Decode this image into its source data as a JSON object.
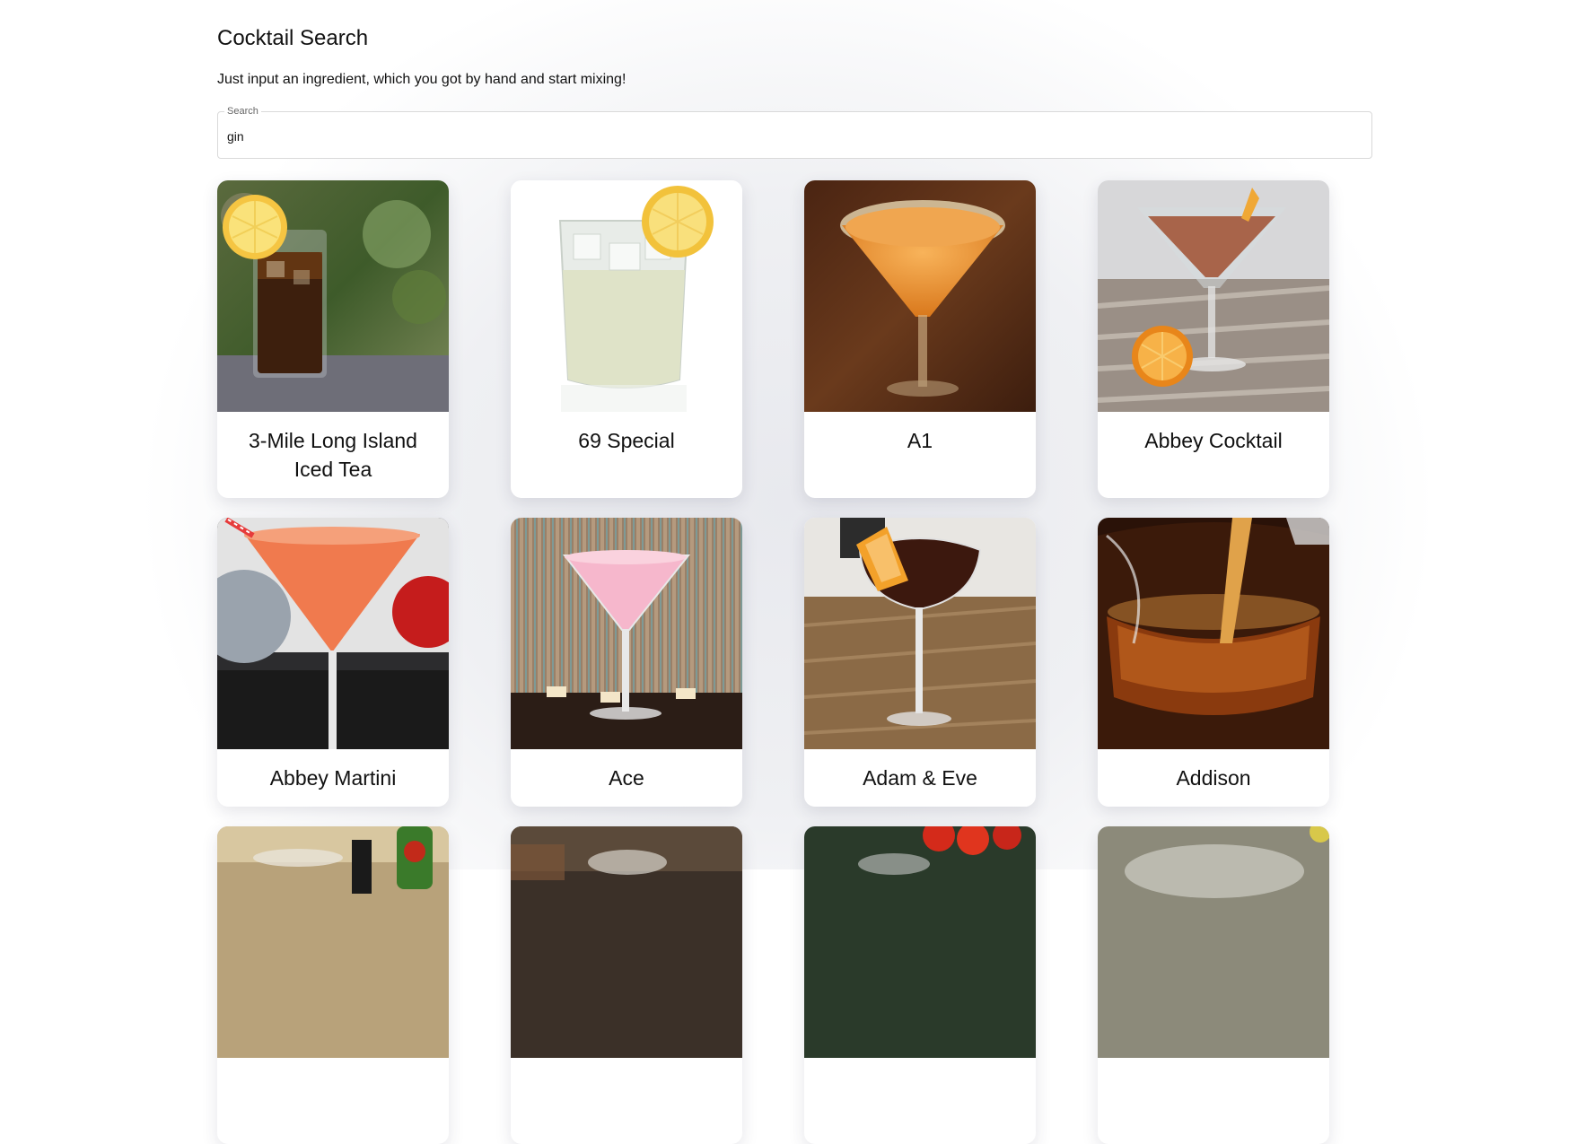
{
  "header": {
    "title": "Cocktail Search",
    "subtitle": "Just input an ingredient, which you got by hand and start mixing!"
  },
  "search": {
    "label": "Search",
    "value": "gin"
  },
  "cocktails": [
    {
      "name": "3-Mile Long Island Iced Tea",
      "image_icon": "iced-tea-highball-icon"
    },
    {
      "name": "69 Special",
      "image_icon": "lemon-rocks-glass-icon"
    },
    {
      "name": "A1",
      "image_icon": "orange-martini-icon"
    },
    {
      "name": "Abbey Cocktail",
      "image_icon": "martini-orange-slice-icon"
    },
    {
      "name": "Abbey Martini",
      "image_icon": "red-martini-icon"
    },
    {
      "name": "Ace",
      "image_icon": "pink-martini-icon"
    },
    {
      "name": "Adam & Eve",
      "image_icon": "dark-coupe-orange-peel-icon"
    },
    {
      "name": "Addison",
      "image_icon": "amber-pour-icon"
    },
    {
      "name": "",
      "image_icon": "bottles-glass-icon"
    },
    {
      "name": "",
      "image_icon": "dark-bar-glass-icon"
    },
    {
      "name": "",
      "image_icon": "tomatoes-glass-icon"
    },
    {
      "name": "",
      "image_icon": "clear-glass-icon"
    }
  ]
}
